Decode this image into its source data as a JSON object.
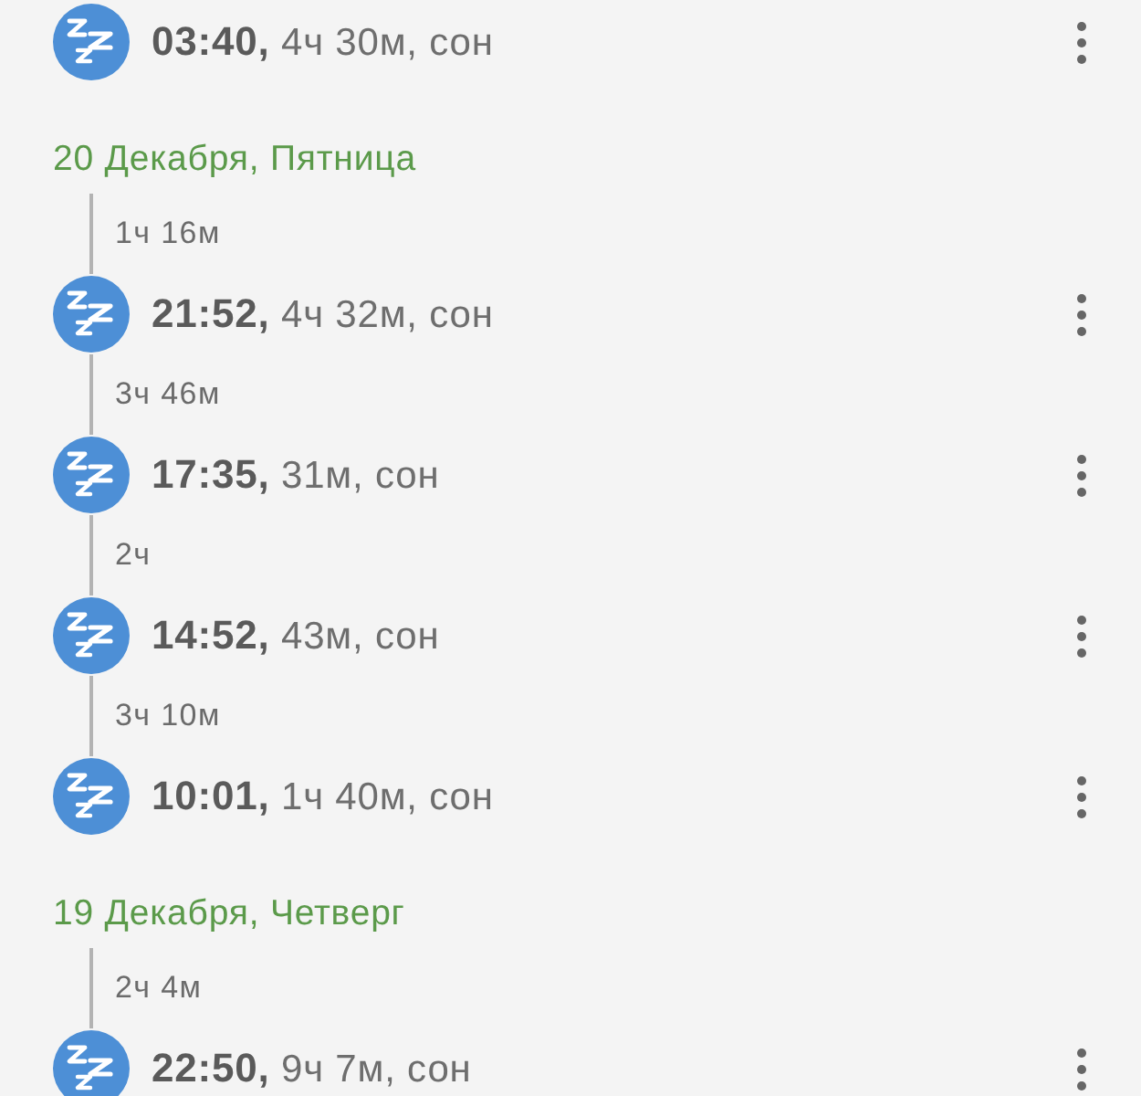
{
  "days": [
    {
      "items": [
        {
          "kind": "sleep",
          "text": "**03:40,** 4ч 30м, сон"
        }
      ]
    },
    {
      "date": "20 Декабря, Пятница",
      "items": [
        {
          "kind": "gap",
          "text": "1ч 16м"
        },
        {
          "kind": "sleep",
          "text": "**21:52,** 4ч 32м, сон"
        },
        {
          "kind": "gap",
          "text": "3ч 46м"
        },
        {
          "kind": "sleep",
          "text": "**17:35,** 31м, сон"
        },
        {
          "kind": "gap",
          "text": "2ч"
        },
        {
          "kind": "sleep",
          "text": "**14:52,** 43м, сон"
        },
        {
          "kind": "gap",
          "text": "3ч 10м"
        },
        {
          "kind": "sleep",
          "text": "**10:01,** 1ч 40м, сон"
        }
      ]
    },
    {
      "date": "19 Декабря, Четверг",
      "items": [
        {
          "kind": "gap",
          "text": "2ч 4м"
        },
        {
          "kind": "sleep",
          "text": "**22:50,** 9ч 7м, сон"
        }
      ]
    }
  ]
}
